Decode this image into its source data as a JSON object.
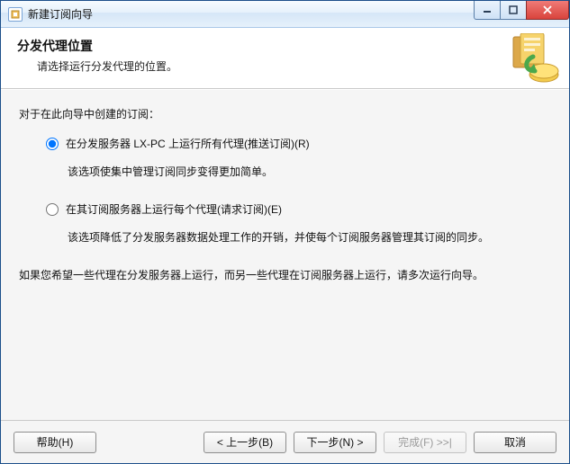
{
  "window": {
    "title": "新建订阅向导"
  },
  "header": {
    "heading": "分发代理位置",
    "subtitle": "请选择运行分发代理的位置。"
  },
  "content": {
    "intro": "对于在此向导中创建的订阅：",
    "option_push": {
      "label": "在分发服务器 LX-PC 上运行所有代理(推送订阅)(R)",
      "desc": "该选项使集中管理订阅同步变得更加简单。",
      "selected": true
    },
    "option_pull": {
      "label": "在其订阅服务器上运行每个代理(请求订阅)(E)",
      "desc": "该选项降低了分发服务器数据处理工作的开销，并使每个订阅服务器管理其订阅的同步。",
      "selected": false
    },
    "note": "如果您希望一些代理在分发服务器上运行，而另一些代理在订阅服务器上运行，请多次运行向导。"
  },
  "buttons": {
    "help": "帮助(H)",
    "back": "< 上一步(B)",
    "next": "下一步(N) >",
    "finish": "完成(F)  >>|",
    "cancel": "取消"
  }
}
